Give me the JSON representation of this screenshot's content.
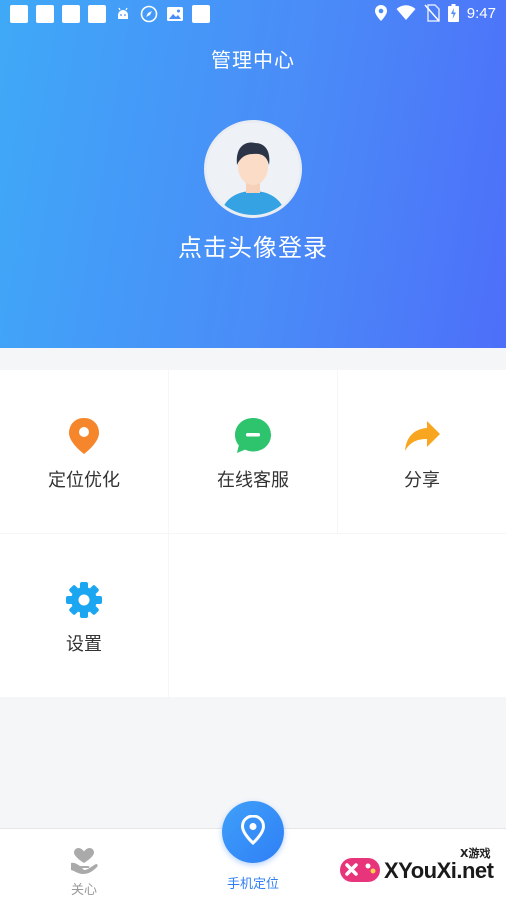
{
  "status_bar": {
    "time": "9:47",
    "icons": [
      "notification-square-icon",
      "notification-square-icon",
      "notification-square-icon",
      "notification-square-icon",
      "android-icon",
      "compass-icon",
      "image-icon",
      "notification-square-icon",
      "location-icon",
      "wifi-icon",
      "no-sim-icon",
      "battery-charging-icon"
    ]
  },
  "header": {
    "title": "管理中心",
    "login_prompt": "点击头像登录",
    "gradient": [
      "#3fa9f7",
      "#4d6ff9"
    ]
  },
  "menu": {
    "items": [
      {
        "label": "定位优化",
        "icon": "location-pin-icon",
        "color": "#f5862b"
      },
      {
        "label": "在线客服",
        "icon": "chat-bubble-icon",
        "color": "#2ec46e"
      },
      {
        "label": "分享",
        "icon": "share-arrow-icon",
        "color": "#f8a51f"
      },
      {
        "label": "设置",
        "icon": "gear-icon",
        "color": "#1ba6f2"
      }
    ]
  },
  "bottom_nav": {
    "tabs": [
      {
        "label": "关心",
        "icon": "heart-hand-icon"
      },
      {
        "label": "手机定位",
        "icon": "location-pin-icon",
        "active": true
      }
    ],
    "accent": "#2f7ff6"
  },
  "watermark": {
    "brand": "XYouXi.net",
    "small": "X游戏"
  }
}
